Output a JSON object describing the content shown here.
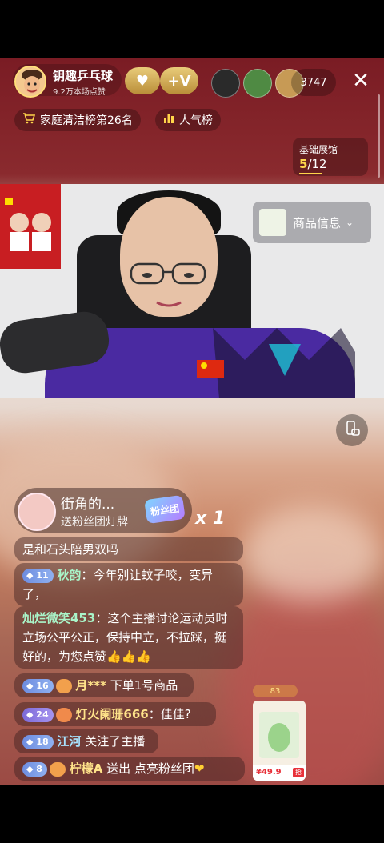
{
  "header": {
    "host_name": "钥趣乒乓球",
    "host_likes": "9.2万本场点赞",
    "follow_label": "+V",
    "viewer_count": "3747",
    "rank_label": "家庭清洁榜第26名",
    "popularity_label": "人气榜",
    "exhibition_title": "基础展馆",
    "exhibition_current": "5",
    "exhibition_total": "12"
  },
  "video": {
    "product_label": "商品信息"
  },
  "gift": {
    "sender": "街角的...",
    "description": "送粉丝团灯牌",
    "badge_text": "粉丝团",
    "multiplier": "x 1"
  },
  "chat": [
    {
      "text": "是和石头陪男双吗"
    },
    {
      "level": "11",
      "user": "秋韵",
      "text": "：今年别让蚊子咬，变异了，"
    },
    {
      "user": "灿烂微笑453",
      "text": "：这个主播讨论运动员时立场公平公正，保持中立，不拉踩，挺好的，为您点赞",
      "emoji": "👍👍👍"
    },
    {
      "level": "16",
      "user": "月***",
      "text": "下单1号商品"
    },
    {
      "level": "24",
      "user": "灯火阑珊666",
      "text": "：佳佳?"
    },
    {
      "level": "18",
      "user": "江河",
      "text": "关注了主播"
    },
    {
      "level": "8",
      "user": "柠檬A",
      "text": "送出 点亮粉丝团"
    }
  ],
  "product": {
    "coin_label": "83",
    "price": "¥49.9",
    "buy_tag": "抢"
  },
  "colors": {
    "accent_gold": "#ffd54a",
    "username_green": "#a9f4c8",
    "username_yellow": "#ffe38a"
  }
}
